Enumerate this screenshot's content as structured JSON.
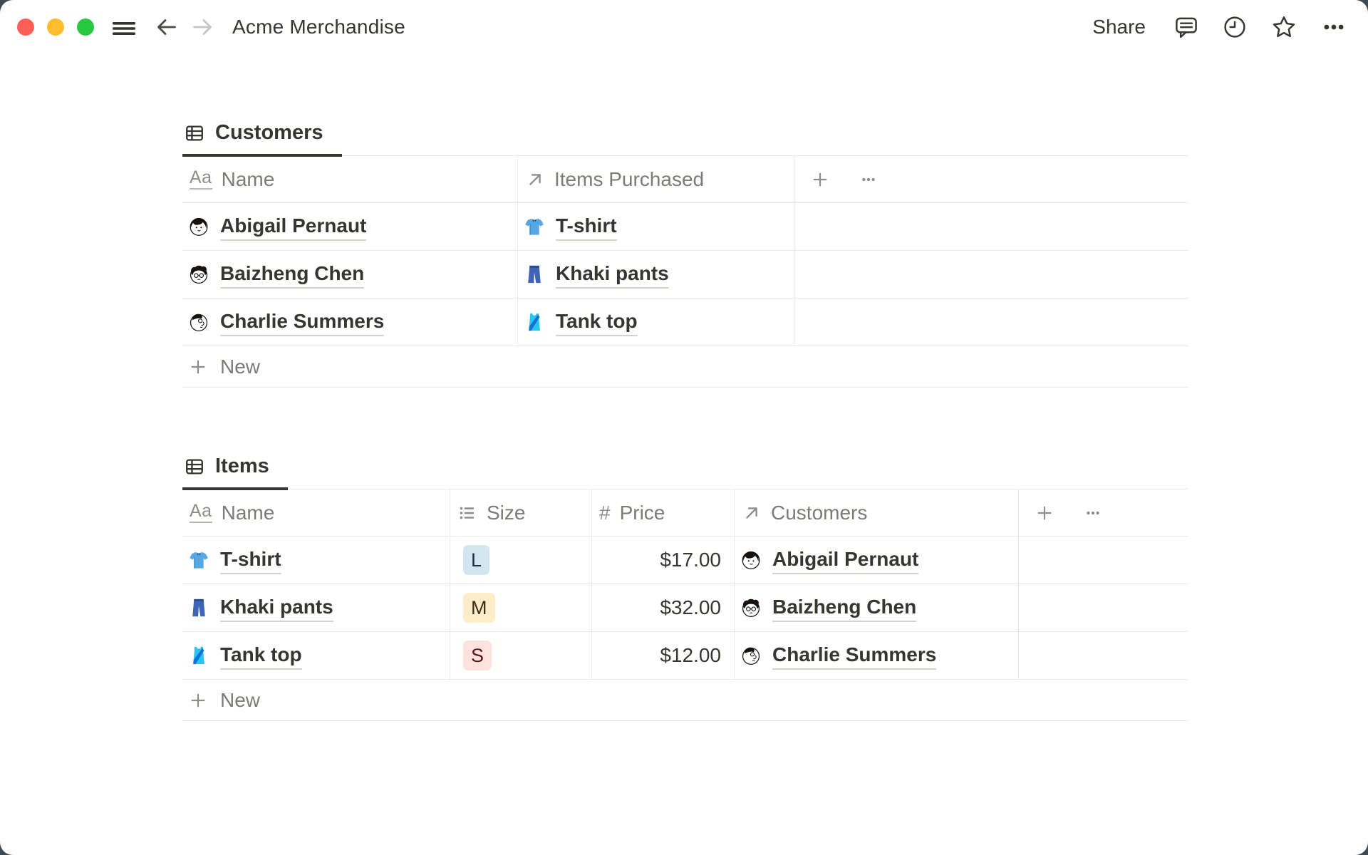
{
  "topbar": {
    "title": "Acme Merchandise",
    "share_label": "Share"
  },
  "customers": {
    "tab_label": "Customers",
    "columns": [
      {
        "label": "Name",
        "type": "title"
      },
      {
        "label": "Items Purchased",
        "type": "relation"
      }
    ],
    "rows": [
      {
        "name": "Abigail Pernaut",
        "item": "T-shirt"
      },
      {
        "name": "Baizheng Chen",
        "item": "Khaki pants"
      },
      {
        "name": "Charlie Summers",
        "item": "Tank top"
      }
    ],
    "new_label": "New"
  },
  "items": {
    "tab_label": "Items",
    "columns": [
      {
        "label": "Name",
        "type": "title"
      },
      {
        "label": "Size",
        "type": "select"
      },
      {
        "label": "Price",
        "type": "number"
      },
      {
        "label": "Customers",
        "type": "relation"
      }
    ],
    "rows": [
      {
        "name": "T-shirt",
        "size": "L",
        "size_bg": "#d3e5ef",
        "size_fg": "#183347",
        "price": "$17.00",
        "customer": "Abigail Pernaut"
      },
      {
        "name": "Khaki pants",
        "size": "M",
        "size_bg": "#fdecc8",
        "size_fg": "#402c1b",
        "price": "$32.00",
        "customer": "Baizheng Chen"
      },
      {
        "name": "Tank top",
        "size": "S",
        "size_bg": "#ffe2dd",
        "size_fg": "#5d1715",
        "price": "$12.00",
        "customer": "Charlie Summers"
      }
    ],
    "new_label": "New"
  },
  "glyphs": {
    "text_property": "Aa",
    "number_property": "#"
  },
  "colors": {
    "primary_text": "#37352f",
    "secondary_text": "#7d7b76",
    "border": "#e9e9e7",
    "desktop_background": "#3e4a54",
    "traffic_red": "#ff5f57",
    "traffic_yellow": "#febc2e",
    "traffic_green": "#28c840"
  }
}
